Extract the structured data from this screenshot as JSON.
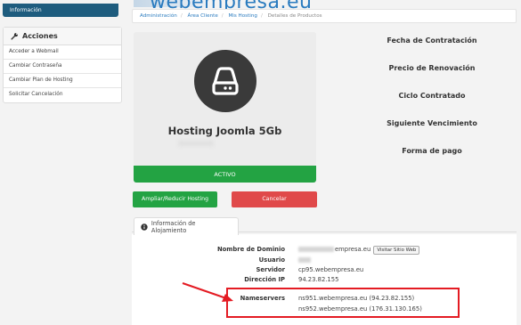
{
  "brand": {
    "logo_text": "webempresa.eu"
  },
  "sidebar": {
    "info_tab": "Información",
    "actions_title": "Acciones",
    "items": [
      {
        "label": "Acceder a Webmail"
      },
      {
        "label": "Cambiar Contraseña"
      },
      {
        "label": "Cambiar Plan de Hosting"
      },
      {
        "label": "Solicitar Cancelación"
      }
    ]
  },
  "breadcrumb": {
    "items": [
      "Administración",
      "Área Cliente",
      "Mis Hosting"
    ],
    "current": "Detalles de Productos"
  },
  "product": {
    "name": "Hosting Joomla 5Gb",
    "status": "ACTIVO",
    "upgrade_button": "Ampliar/Reducir Hosting",
    "cancel_button": "Cancelar"
  },
  "details": {
    "labels": [
      "Fecha de Contratación",
      "Precio de Renovación",
      "Ciclo Contratado",
      "Siguiente Vencimiento",
      "Forma de pago"
    ]
  },
  "hosting_info": {
    "tab_label": "Información de Alojamiento",
    "domain_label": "Nombre de Dominio",
    "domain_value": "empresa.eu",
    "visit_button": "Visitar Sitio Web",
    "user_label": "Usuario",
    "server_label": "Servidor",
    "server_value": "cp95.webempresa.eu",
    "ip_label": "Dirección IP",
    "ip_value": "94.23.82.155",
    "nameservers_label": "Nameservers",
    "ns1": "ns951.webempresa.eu (94.23.82.155)",
    "ns2": "ns952.webempresa.eu (176.31.130.165)"
  },
  "colors": {
    "active_green": "#23a343",
    "cancel_red": "#e0494a",
    "sidebar_blue": "#1e5c7e",
    "highlight_red": "#e41b23"
  }
}
